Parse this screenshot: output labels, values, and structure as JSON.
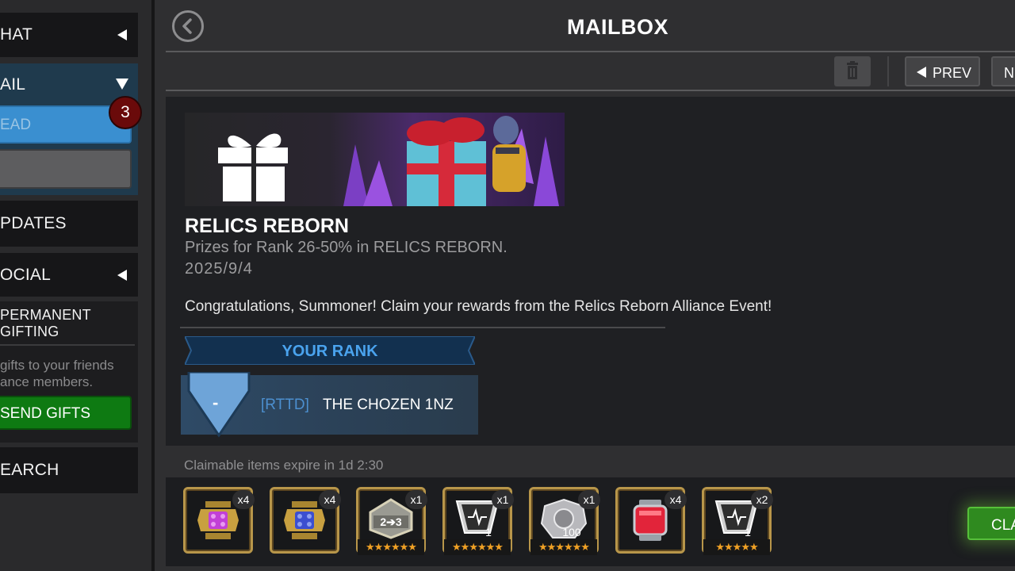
{
  "sidebar": {
    "chat_label": "HAT",
    "mail_label": "AIL",
    "read_label": "EAD",
    "unread_count": "3",
    "updates_label": "PDATES",
    "social_label": "OCIAL",
    "permanent_gifting_line1": "PERMANENT",
    "permanent_gifting_line2": "GIFTING",
    "gift_desc_line1": "gifts to your friends",
    "gift_desc_line2": "ance members.",
    "send_gifts_label": "SEND GIFTS",
    "search_label": "EARCH"
  },
  "header": {
    "title": "MAILBOX",
    "prev_label": "PREV",
    "next_label": "NE"
  },
  "message": {
    "title": "RELICS REBORN",
    "subtitle": "Prizes for Rank 26-50% in RELICS REBORN.",
    "date": "2025/9/4",
    "body": "Congratulations, Summoner! Claim your rewards from the Relics Reborn Alliance Event!",
    "rank_header": "YOUR RANK",
    "rank_value": "-",
    "alliance_tag": "[RTTD]",
    "player_name": "THE CHOZEN 1NZ"
  },
  "rewards": {
    "expire_text": "Claimable items expire in 1d 2:30",
    "claim_label": "CLAIM",
    "items": [
      {
        "icon": "purple-relic-crystal-icon",
        "qty": "x4",
        "accent": "#c23fd6"
      },
      {
        "icon": "blue-relic-crystal-icon",
        "qty": "x4",
        "accent": "#3b4fd0"
      },
      {
        "icon": "rank-up-gem-icon",
        "qty": "x1",
        "label": "2➔3",
        "stars": "★★★★★★"
      },
      {
        "icon": "signature-stone-icon",
        "qty": "x1",
        "label": "1",
        "stars": "★★★★★★"
      },
      {
        "icon": "relic-dust-shards-icon",
        "qty": "x1",
        "label": "100",
        "stars": "★★★★★★"
      },
      {
        "icon": "red-relic-canister-icon",
        "qty": "x4",
        "accent": "#e2243a"
      },
      {
        "icon": "signature-stone-icon",
        "qty": "x2",
        "label": "1",
        "stars": "★★★★★"
      }
    ]
  }
}
